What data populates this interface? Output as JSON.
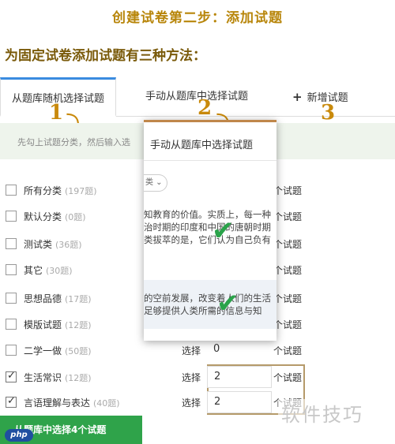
{
  "header": {
    "title": "创建试卷第二步：添加试题",
    "subtitle": "为固定试卷添加试题有三种方法："
  },
  "tabs": [
    {
      "label": "从题库随机选择试题",
      "number": "1"
    },
    {
      "label": "手动从题库中选择试题",
      "number": "2"
    },
    {
      "label": "新增试题",
      "number": "3"
    }
  ],
  "hint": "先勾上试题分类，然后输入选",
  "categories": [
    {
      "name": "所有分类",
      "count": "(197题)",
      "checked": false,
      "select": "",
      "qty": "",
      "unit": "个试题"
    },
    {
      "name": "默认分类",
      "count": "(0题)",
      "checked": false,
      "select": "",
      "qty": "",
      "unit": "个试题"
    },
    {
      "name": "测试类",
      "count": "(36题)",
      "checked": false,
      "select": "",
      "qty": "",
      "unit": "个试题"
    },
    {
      "name": "其它",
      "count": "(30题)",
      "checked": false,
      "select": "",
      "qty": "",
      "unit": "个试题"
    },
    {
      "name": "思想品德",
      "count": "(17题)",
      "checked": false,
      "select": "",
      "qty": "",
      "unit": "个试题"
    },
    {
      "name": "模版试题",
      "count": "(12题)",
      "checked": false,
      "select": "",
      "qty": "",
      "unit": "个试题"
    },
    {
      "name": "二学一做",
      "count": "(50题)",
      "checked": false,
      "select": "选择",
      "qty": "0",
      "unit": "个试题"
    },
    {
      "name": "生活常识",
      "count": "(12题)",
      "checked": true,
      "select": "选择",
      "qty": "2",
      "unit": "个试题"
    },
    {
      "name": "言语理解与表达",
      "count": "(40题)",
      "checked": true,
      "select": "选择",
      "qty": "2",
      "unit": "个试题"
    }
  ],
  "popup": {
    "title": "手动从题库中选择试题",
    "dropdown": "类",
    "para1": [
      "知教育的价值。实质上，每一种",
      "治时期的印度和中国的唐朝时期",
      "类拔萃的是，它们认为自己负有"
    ],
    "para2": [
      "的空前发展，改变着人们的生活",
      "足够提供人类所需的信息与知"
    ]
  },
  "submit_button": "从题库中选择4个试题",
  "watermark": "软件技巧",
  "logo_text": "php",
  "colors": {
    "accent_gold": "#c98a0c",
    "check_green": "#2aa34a",
    "button_green": "#2fa34a",
    "tab_blue": "#3a8be0"
  }
}
